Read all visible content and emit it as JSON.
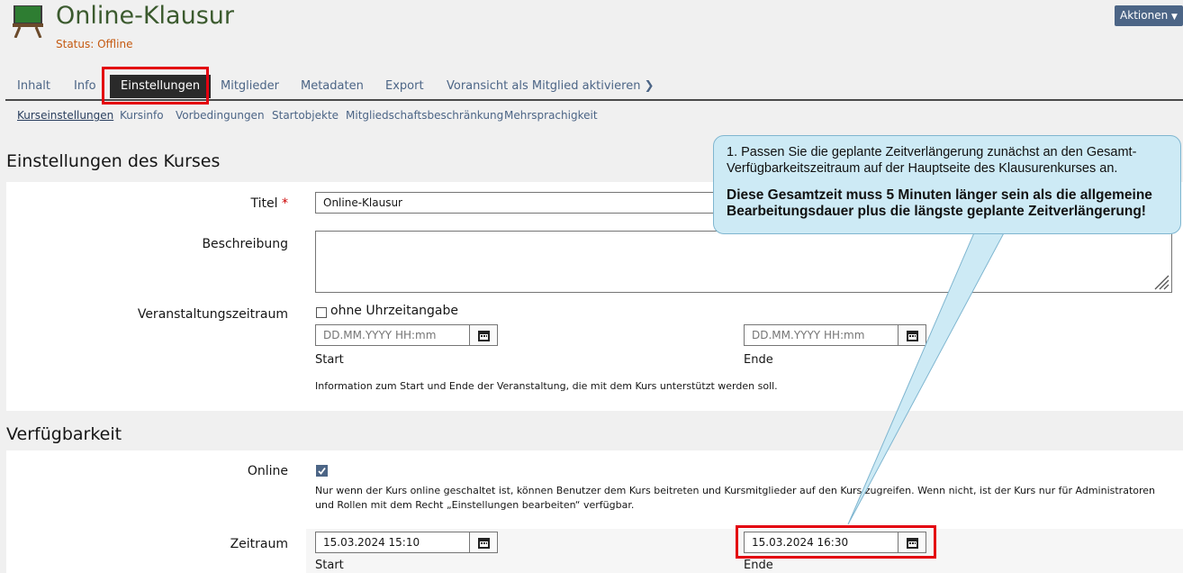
{
  "header": {
    "title": "Online-Klausur",
    "status": "Status: Offline",
    "actions_label": "Aktionen"
  },
  "tabs": [
    {
      "label": "Inhalt"
    },
    {
      "label": "Info"
    },
    {
      "label": "Einstellungen",
      "active": true
    },
    {
      "label": "Mitglieder"
    },
    {
      "label": "Metadaten"
    },
    {
      "label": "Export"
    },
    {
      "label": "Voransicht als Mitglied aktivieren"
    }
  ],
  "subtabs": [
    {
      "label": "Kurseinstellungen",
      "active": true
    },
    {
      "label": "Kursinfo"
    },
    {
      "label": "Vorbedingungen"
    },
    {
      "label": "Startobjekte"
    },
    {
      "label": "Mitgliedschaftsbeschränkung"
    },
    {
      "label": "Mehrsprachigkeit"
    }
  ],
  "course_settings": {
    "section_title": "Einstellungen des Kurses",
    "title_label": "Titel",
    "title_required_mark": "*",
    "title_value": "Online-Klausur",
    "description_label": "Beschreibung",
    "event_period_label": "Veranstaltungszeitraum",
    "no_time_label": "ohne Uhrzeitangabe",
    "start_placeholder": "DD.MM.YYYY HH:mm",
    "end_placeholder": "DD.MM.YYYY HH:mm",
    "start_label": "Start",
    "end_label": "Ende",
    "info_text": "Information zum Start und Ende der Veranstaltung, die mit dem Kurs unterstützt werden soll."
  },
  "availability": {
    "section_title": "Verfügbarkeit",
    "online_label": "Online",
    "online_checked": true,
    "online_info": "Nur wenn der Kurs online geschaltet ist, können Benutzer dem Kurs beitreten und Kursmitglieder auf den Kurs zugreifen. Wenn nicht, ist der Kurs nur für Administratoren und Rollen mit dem Recht „Einstellungen bearbeiten“ verfügbar.",
    "period_label": "Zeitraum",
    "start_value": "15.03.2024 15:10",
    "end_value": "15.03.2024 16:30",
    "start_label": "Start",
    "end_label": "Ende"
  },
  "callout": {
    "line1": "1. Passen Sie die geplante Zeitverlängerung zunächst an den Gesamt-Verfügbarkeitszeitraum auf der Hauptseite des Klausurenkurses an.",
    "line2": "Diese Gesamtzeit muss 5 Minuten länger sein als die allgemeine Bearbeitungsdauer plus die längste geplante Zeitverlängerung!"
  },
  "colors": {
    "accent": "#4c6586",
    "title_green": "#3b5a2e",
    "status_orange": "#c55a11",
    "highlight_red": "#e3000f",
    "callout_bg": "#cdeaf5"
  }
}
